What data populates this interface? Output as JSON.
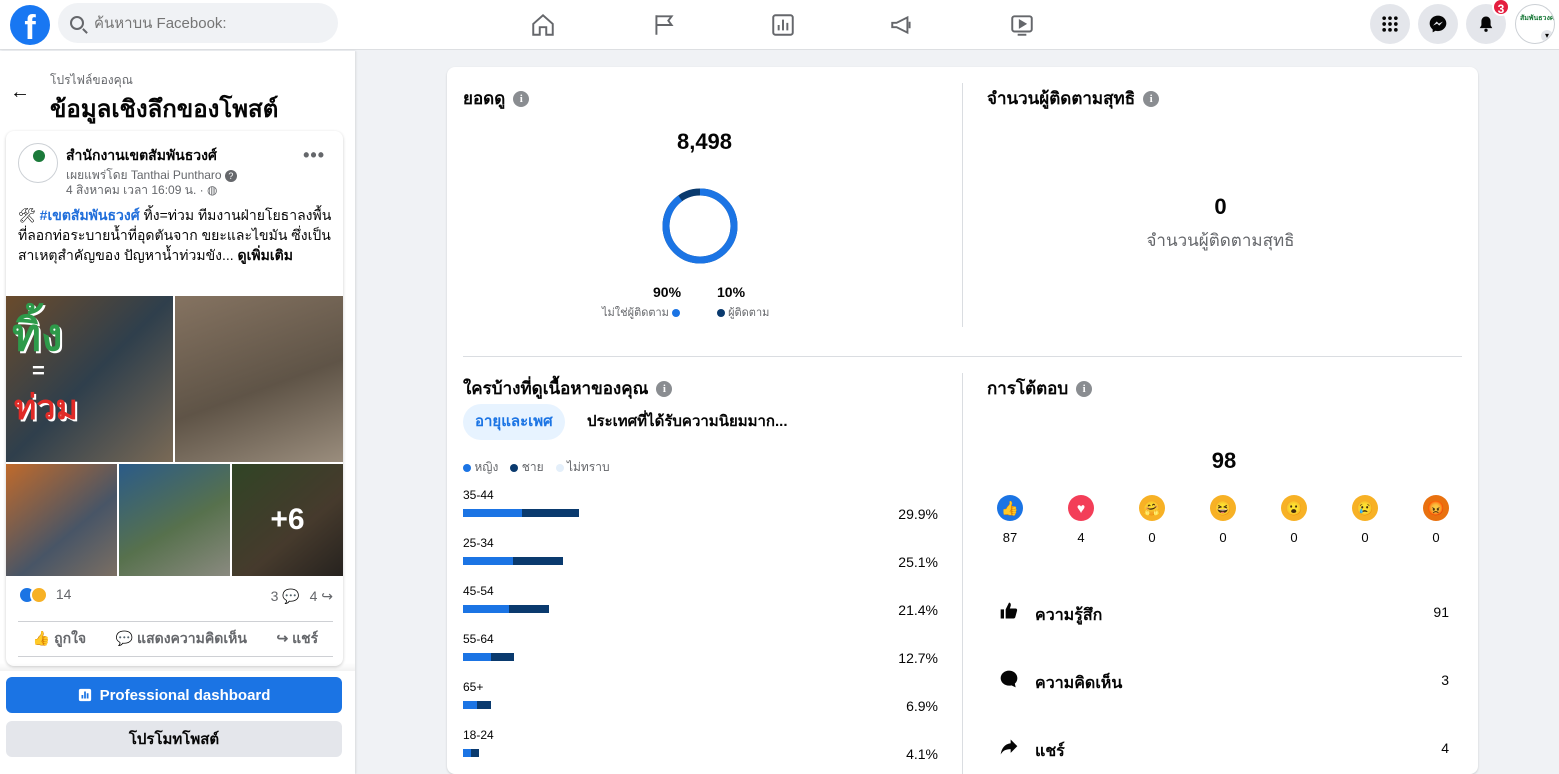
{
  "topbar": {
    "logo": "f",
    "search_placeholder": "ค้นหาบน Facebook:",
    "notifications_badge": "3",
    "profile_mini": "สัมพันธวงศ์"
  },
  "left": {
    "breadcrumb": "โปรไฟล์ของคุณ",
    "title": "ข้อมูลเชิงลึกของโพสต์",
    "post": {
      "page_name": "สำนักงานเขตสัมพันธวงศ์",
      "published_by": "เผยแพร่โดย Tanthai Puntharo",
      "date": "4 สิงหาคม เวลา 16:09 น. ·",
      "text_prefix": "🛠 ",
      "hashtag": "#เขตสัมพันธวงศ์",
      "text_body": " ทิ้ง=ท่วม ทีมงานฝ่ายโยธาลงพื้นที่ลอกท่อระบายน้ำที่อุดตันจาก ขยะและไขมัน ซึ่งเป็นสาเหตุสำคัญของ ปัญหาน้ำท่วมขัง... ",
      "see_more": "ดูเพิ่มเติม",
      "photo_text_1": "ทิ้ง",
      "photo_text_eq": "=",
      "photo_text_2": "ท่วม",
      "more_photos": "+6",
      "reactions_count": "14",
      "comments_count": "3",
      "shares_count": "4",
      "like_label": "ถูกใจ",
      "comment_label": "แสดงความคิดเห็น",
      "share_label": "แชร์"
    },
    "dashboard_button": "Professional dashboard",
    "promote_button": "โปรโมทโพสต์"
  },
  "views": {
    "title": "ยอดดู",
    "total": "8,498",
    "non_followers_pct": "90%",
    "non_followers_label": "ไม่ใช่ผู้ติดตาม",
    "followers_pct": "10%",
    "followers_label": "ผู้ติดตาม",
    "non_followers_share": 0.9,
    "colors": {
      "non_followers": "#1b74e4",
      "followers": "#0a3a6e"
    }
  },
  "net_followers": {
    "title": "จำนวนผู้ติดตามสุทธิ",
    "value": "0",
    "label": "จำนวนผู้ติดตามสุทธิ"
  },
  "audience": {
    "title": "ใครบ้างที่ดูเนื้อหาของคุณ",
    "tab_active": "อายุและเพศ",
    "tab_other": "ประเทศที่ได้รับความนิยมมาก...",
    "legend": [
      {
        "label": "หญิง",
        "color": "#1b74e4"
      },
      {
        "label": "ชาย",
        "color": "#0a3a6e"
      },
      {
        "label": "ไม่ทราบ",
        "color": "#e4effa"
      }
    ],
    "rows": [
      {
        "age": "35-44",
        "pct": "29.9%",
        "female": 14.8,
        "male": 14.1
      },
      {
        "age": "25-34",
        "pct": "25.1%",
        "female": 12.6,
        "male": 12.5
      },
      {
        "age": "45-54",
        "pct": "21.4%",
        "female": 11.6,
        "male": 9.8
      },
      {
        "age": "55-64",
        "pct": "12.7%",
        "female": 7.1,
        "male": 5.6
      },
      {
        "age": "65+",
        "pct": "6.9%",
        "female": 3.4,
        "male": 3.5
      },
      {
        "age": "18-24",
        "pct": "4.1%",
        "female": 2.0,
        "male": 2.1
      }
    ]
  },
  "interactions": {
    "title": "การโต้ตอบ",
    "total": "98",
    "reactions": [
      {
        "name": "like",
        "count": "87",
        "color": "#1b74e4",
        "glyph": "👍"
      },
      {
        "name": "love",
        "count": "4",
        "color": "#f33e58",
        "glyph": "♥"
      },
      {
        "name": "care",
        "count": "0",
        "color": "#f7b125",
        "glyph": "🤗"
      },
      {
        "name": "haha",
        "count": "0",
        "color": "#f7b125",
        "glyph": "😆"
      },
      {
        "name": "wow",
        "count": "0",
        "color": "#f7b125",
        "glyph": "😮"
      },
      {
        "name": "sad",
        "count": "0",
        "color": "#f7b125",
        "glyph": "😢"
      },
      {
        "name": "angry",
        "count": "0",
        "color": "#e9710f",
        "glyph": "😡"
      }
    ],
    "engagement": [
      {
        "label": "ความรู้สึก",
        "value": "91",
        "icon": "thumbs-up-icon"
      },
      {
        "label": "ความคิดเห็น",
        "value": "3",
        "icon": "comment-icon"
      },
      {
        "label": "แชร์",
        "value": "4",
        "icon": "share-icon"
      }
    ]
  }
}
